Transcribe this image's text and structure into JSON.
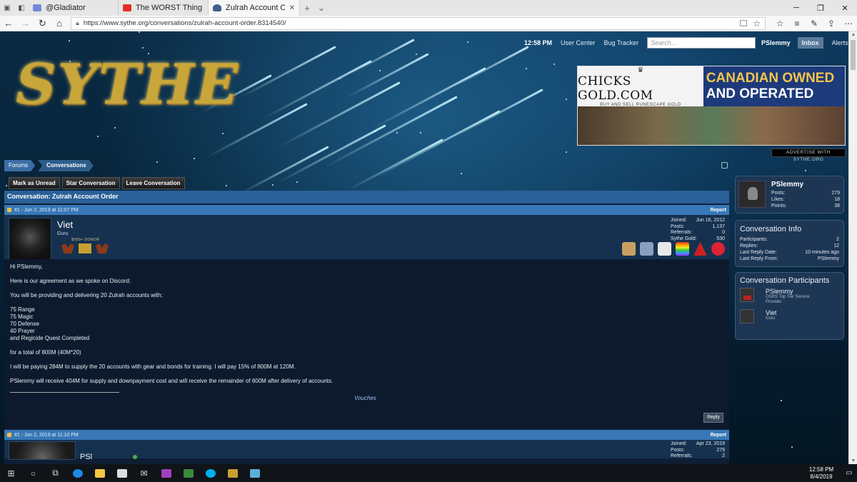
{
  "browser": {
    "tabs": [
      {
        "label": "@Gladiator",
        "icon": "discord-icon"
      },
      {
        "label": "The WORST Thing That's Ev",
        "icon": "youtube-icon"
      },
      {
        "label": "Zulrah Account Order |",
        "icon": "sythe-icon",
        "active": true
      }
    ],
    "url": "https://www.sythe.org/conversations/zulrah-account-order.8314540/"
  },
  "header": {
    "time": "12:58 PM",
    "user_center": "User Center",
    "bug_tracker": "Bug Tracker",
    "search_placeholder": "Search...",
    "username": "PSlemmy",
    "inbox": "Inbox",
    "alerts": "Alerts",
    "logo": "SYTHE"
  },
  "ad": {
    "brand": "CHICKS GOLD.COM",
    "brand_tag": "BUY AND SELL RUNESCAPE GOLD",
    "slogan_1": "CANADIAN OWNED",
    "slogan_2": "AND OPERATED",
    "advertise_link": "ADVERTISE WITH SYTHE.ORG"
  },
  "breadcrumb": {
    "forums": "Forums",
    "conversations": "Conversations"
  },
  "actions": {
    "mark_unread": "Mark as Unread",
    "star": "Star Conversation",
    "leave": "Leave Conversation"
  },
  "conversation": {
    "title": "Conversation: Zulrah Account Order",
    "posts": [
      {
        "meta": "#1 - Jun 2, 2019 at 11:07 PM",
        "report": "Report",
        "user": "Viet",
        "user_title": "Guru",
        "donor": "$500+ DONOR",
        "stats": {
          "joined_label": "Joined:",
          "joined": "Jun 16, 2012",
          "posts_label": "Posts:",
          "posts": "1,137",
          "referrals_label": "Referrals:",
          "referrals": "0",
          "gold_label": "Sythe Gold:",
          "gold": "530"
        },
        "body": [
          "Hi PSlemmy,",
          "Here is our agreement as we spoke on Discord;",
          "You will be providing and delivering 20 Zulrah accounts with;",
          "75 Range\n75 Magic\n70 Defense\n40 Prayer\nand Regicide Quest Completed",
          "for a total of 800M (40M*20)",
          "I will be paying 284M to supply the 20 accounts with gear and bonds for training. I will pay 15% of 800M at 120M.",
          "PSlemmy will receive 404M for supply and downpayment cost and will receive the remainder of 600M after delivery of accounts."
        ],
        "vouches": "Vouches",
        "reply": "Reply"
      },
      {
        "meta": "#1 - Jun 2, 2019 at 11:10 PM",
        "report": "Report",
        "user": "PSl",
        "stats": {
          "joined_label": "Joined:",
          "joined": "Apr 23, 2019",
          "posts_label": "Posts:",
          "posts": "279",
          "referrals_label": "Referrals:",
          "referrals": "2"
        }
      }
    ]
  },
  "sidebar": {
    "profile": {
      "name": "PSlemmy",
      "posts_label": "Posts:",
      "posts": "279",
      "likes_label": "Likes:",
      "likes": "18",
      "points_label": "Points:",
      "points": "38"
    },
    "info": {
      "title": "Conversation Info",
      "participants_label": "Participants:",
      "participants": "2",
      "replies_label": "Replies:",
      "replies": "12",
      "last_reply_date_label": "Last Reply Date:",
      "last_reply_date": "10 minutes ago",
      "last_reply_from_label": "Last Reply From:",
      "last_reply_from": "PSlemmy"
    },
    "participants": {
      "title": "Conversation Participants",
      "list": [
        {
          "name": "PSlemmy",
          "title": "OSRS Top Tier Service Provider"
        },
        {
          "name": "Viet",
          "title": "Guru"
        }
      ]
    }
  },
  "taskbar": {
    "time": "12:58 PM",
    "date": "8/4/2019"
  },
  "colors": {
    "accent_blue": "#2a6098",
    "post_header": "#3878b8",
    "logo_gold": "#c9a63a"
  }
}
